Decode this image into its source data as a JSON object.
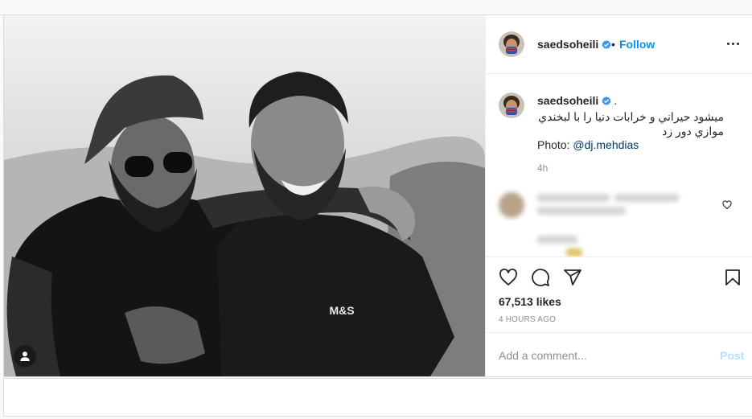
{
  "colors": {
    "accent": "#0095f6",
    "verified": "#3897f0",
    "link": "#00376b",
    "post_disabled": "#b2dffc"
  },
  "header": {
    "username": "saedsoheili",
    "separator": "•",
    "follow_label": "Follow",
    "verified_icon": "verified-badge-icon",
    "more_icon": "more-options-icon"
  },
  "caption": {
    "username": "saedsoheili",
    "dot": ".",
    "text_line1": "میشود حیراني و خرابات دنیا را با لبخندي",
    "text_line2": "موازي دور زد",
    "photo_label": "Photo:",
    "photo_handle": "@dj.mehdias",
    "time": "4h"
  },
  "photo": {
    "shirt_text": "M&S",
    "user_tag_icon": "user-tag-icon"
  },
  "actions": {
    "like_icon": "heart-icon",
    "comment_icon": "comment-icon",
    "share_icon": "share-icon",
    "save_icon": "bookmark-icon",
    "likes": "67,513 likes",
    "time_ago": "4 HOURS AGO"
  },
  "comment_box": {
    "placeholder": "Add a comment...",
    "post_label": "Post"
  }
}
